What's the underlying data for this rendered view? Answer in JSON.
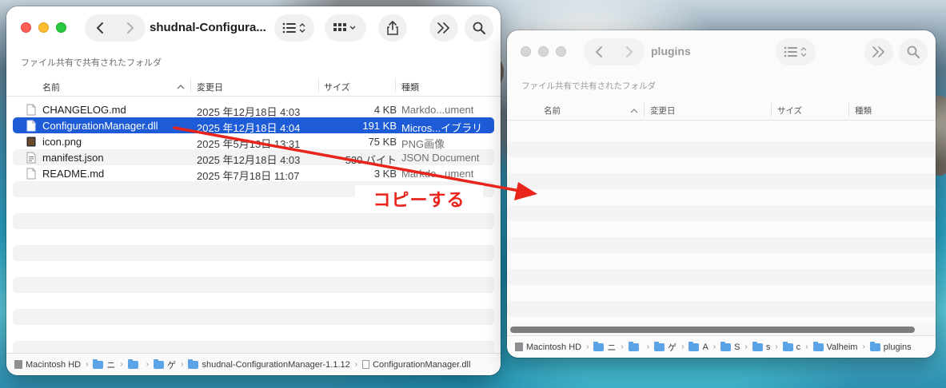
{
  "colors": {
    "selection": "#1e5bd7",
    "annotation": "#e8241b"
  },
  "window_a": {
    "title": "shudnal-Configura...",
    "section_label": "ファイル共有で共有されたフォルダ",
    "columns": {
      "name": "名前",
      "date": "変更日",
      "size": "サイズ",
      "kind": "種類"
    },
    "files": [
      {
        "name": "CHANGELOG.md",
        "date": "2025 年12月18日 4:03",
        "size": "4 KB",
        "kind": "Markdo...ument",
        "icon": "document-icon",
        "selected": false
      },
      {
        "name": "ConfigurationManager.dll",
        "date": "2025 年12月18日 4:04",
        "size": "191 KB",
        "kind": "Micros...イブラリ",
        "icon": "document-icon",
        "selected": true
      },
      {
        "name": "icon.png",
        "date": "2025 年5月13日 13:31",
        "size": "75 KB",
        "kind": "PNG画像",
        "icon": "image-icon",
        "selected": false
      },
      {
        "name": "manifest.json",
        "date": "2025 年12月18日 4:03",
        "size": "530 バイト",
        "kind": "JSON Document",
        "icon": "json-icon",
        "selected": false
      },
      {
        "name": "README.md",
        "date": "2025 年7月18日 11:07",
        "size": "3 KB",
        "kind": "Markdo...ument",
        "icon": "document-icon",
        "selected": false
      }
    ],
    "path": {
      "disk": "Macintosh HD",
      "folder1": "ニ",
      "folder2": "",
      "folder3": "ゲ",
      "folder4": "shudnal-ConfigurationManager-1.1.12",
      "file": "ConfigurationManager.dll"
    }
  },
  "window_b": {
    "title": "plugins",
    "section_label": "ファイル共有で共有されたフォルダ",
    "columns": {
      "name": "名前",
      "date": "変更日",
      "size": "サイズ",
      "kind": "種類"
    },
    "path": {
      "disk": "Macintosh HD",
      "f1": "ニ",
      "f2": "",
      "f3": "ゲ",
      "f4": "A",
      "f5": "S",
      "f6": "s",
      "f7": "c",
      "f8": "Valheim",
      "f9": "plugins"
    }
  },
  "annotation": {
    "text": "コピーする"
  }
}
